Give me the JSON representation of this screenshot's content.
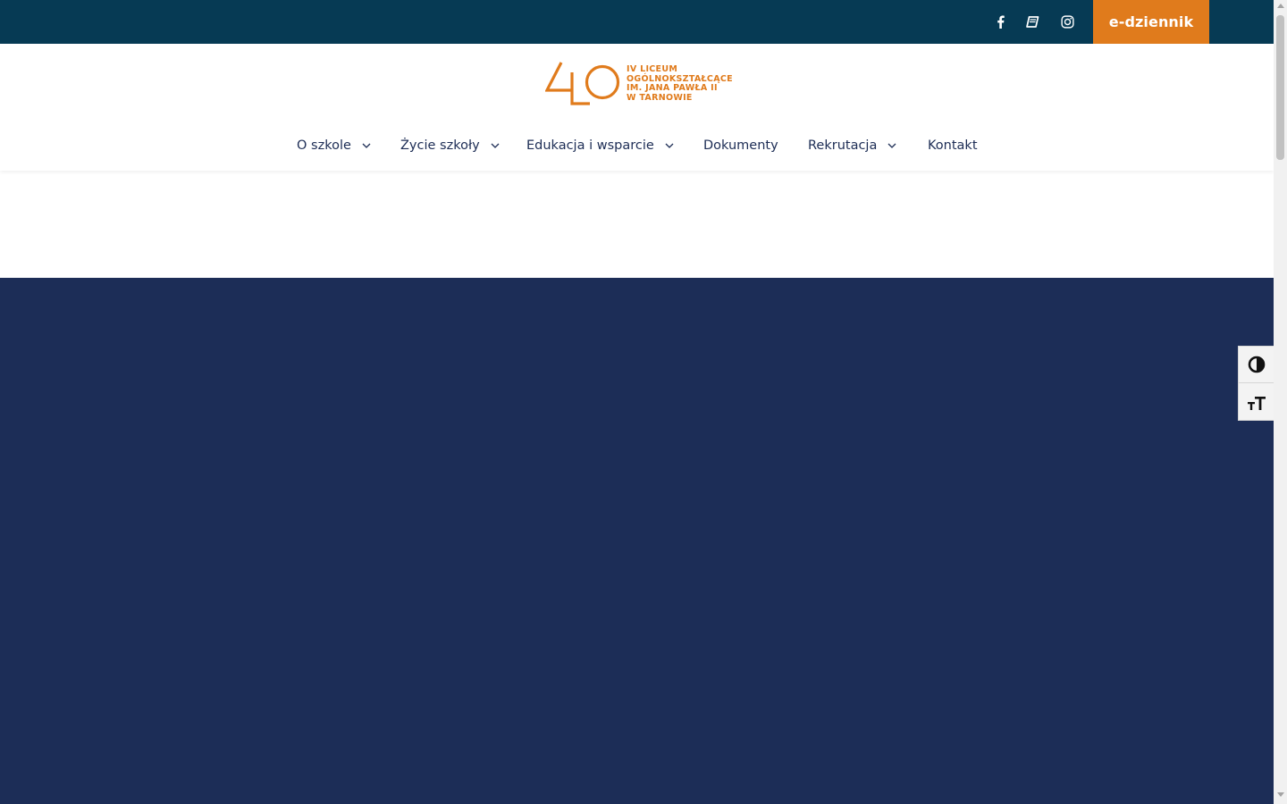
{
  "topbar": {
    "social": [
      {
        "icon": "facebook-icon"
      },
      {
        "icon": "book-icon"
      },
      {
        "icon": "instagram-icon"
      }
    ],
    "cta_label": "e-dziennik"
  },
  "logo": {
    "line1": "IV LICEUM",
    "line2": "OGÓLNOKSZTAŁCĄCE",
    "line3": "IM. JANA PAWŁA II",
    "line4": "W TARNOWIE"
  },
  "nav": {
    "items": [
      {
        "label": "O szkole",
        "has_dropdown": true
      },
      {
        "label": "Życie szkoły",
        "has_dropdown": true
      },
      {
        "label": "Edukacja i wsparcie",
        "has_dropdown": true
      },
      {
        "label": "Dokumenty",
        "has_dropdown": false
      },
      {
        "label": "Rekrutacja",
        "has_dropdown": true
      },
      {
        "label": "Kontakt",
        "has_dropdown": false
      }
    ]
  },
  "accessibility": {
    "buttons": [
      {
        "icon": "contrast-icon"
      },
      {
        "icon": "font-size-icon"
      }
    ]
  },
  "colors": {
    "topbar_bg": "#063a54",
    "accent_orange": "#e07b1c",
    "nav_text": "#1d2d55",
    "hero_bg": "#1c2d57"
  }
}
